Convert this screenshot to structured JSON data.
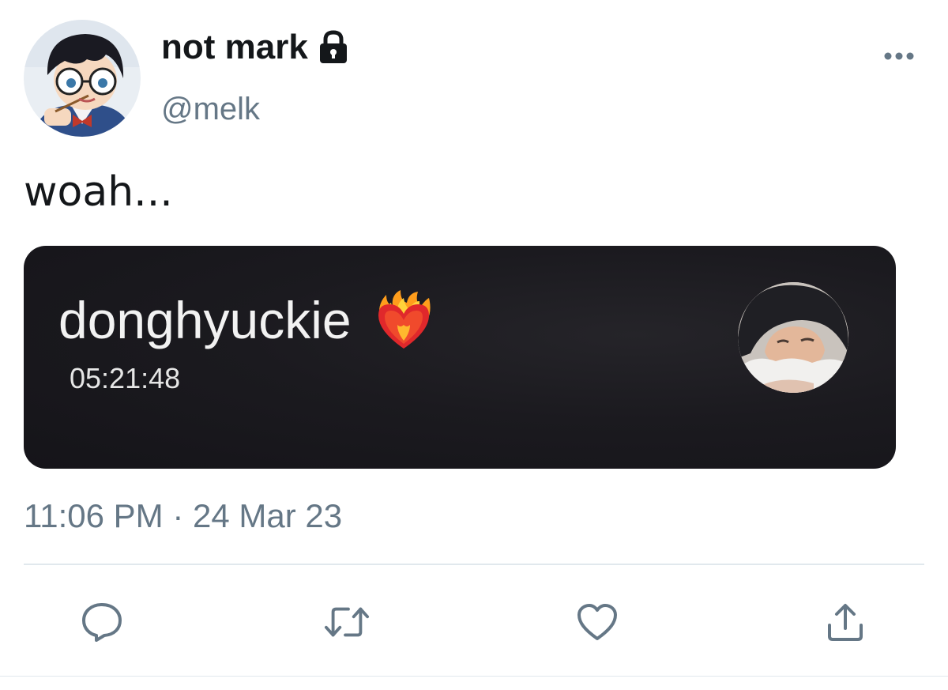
{
  "tweet": {
    "author": {
      "display_name": "not mark",
      "handle": "@melk",
      "locked": true,
      "avatar_icon": "anime-avatar-icon"
    },
    "text": "woah...",
    "timestamp": "11:06 PM · 24 Mar 23",
    "more_icon": "more-dots-icon"
  },
  "media": {
    "contact_name": "donghyuckie",
    "emoji": "heart-on-fire",
    "timer": "05:21:48",
    "avatar_icon": "contact-photo-icon",
    "background": "#1b1a1f"
  },
  "actions": [
    {
      "name": "reply",
      "icon": "reply-icon"
    },
    {
      "name": "retweet",
      "icon": "retweet-icon"
    },
    {
      "name": "like",
      "icon": "heart-icon"
    },
    {
      "name": "share",
      "icon": "share-icon"
    }
  ],
  "colors": {
    "text_primary": "#14171a",
    "text_secondary": "#657786",
    "divider": "#e1e8ed",
    "card_text": "#f2f2f2"
  }
}
